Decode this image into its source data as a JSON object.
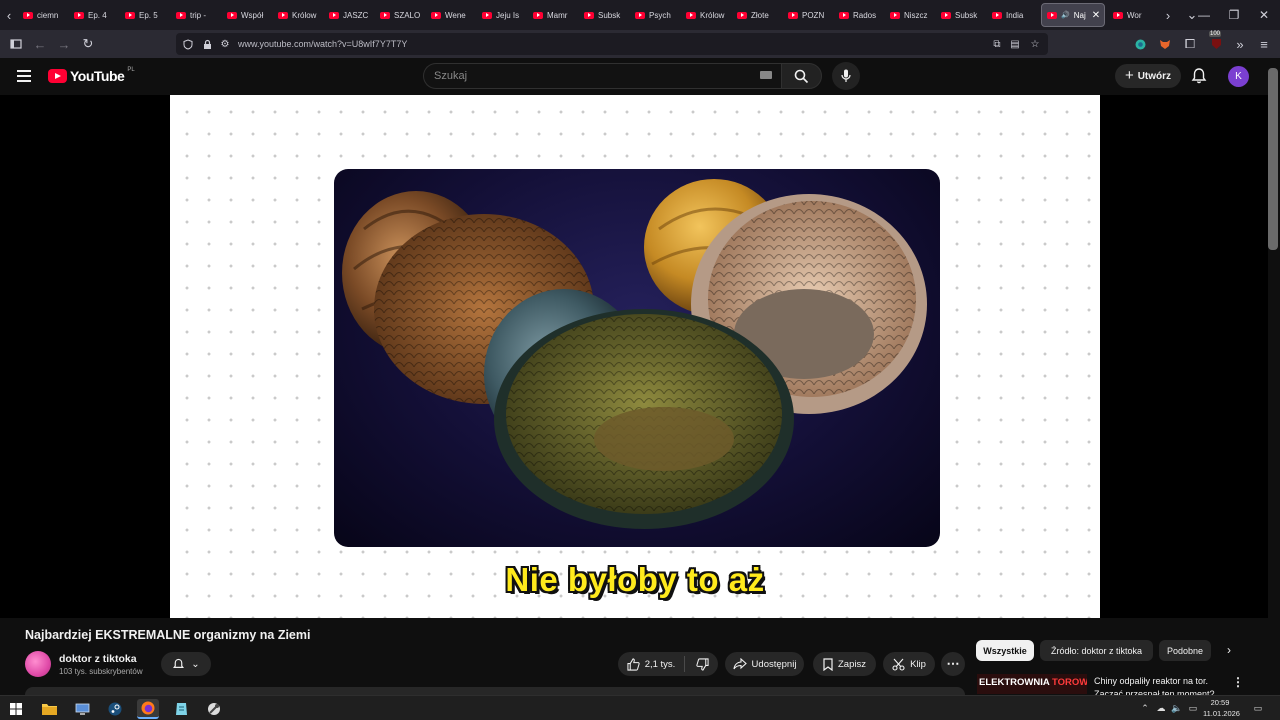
{
  "browser": {
    "tabs": [
      "ciemn",
      "Ep. 4",
      "Ep. 5",
      "trip -",
      "Współ",
      "Królow",
      "JASZC",
      "SZALO",
      "Wene",
      "Jeju Is",
      "Mamr",
      "Subsk",
      "Psych",
      "Królow",
      "Złote",
      "POZN",
      "Rados",
      "Niszcz",
      "Subsk",
      "India",
      "Naj",
      "Wor"
    ],
    "active_tab_index": 20,
    "url": "www.youtube.com/watch?v=U8wIf7Y7T7Y",
    "extension_badge": "100"
  },
  "youtube": {
    "logo_text": "YouTube",
    "region": "PL",
    "search_placeholder": "Szukaj",
    "create_label": "Utwórz",
    "account_initial": "K"
  },
  "player": {
    "caption": "Nie byłoby to aż"
  },
  "video": {
    "title": "Najbardziej EKSTREMALNE organizmy na Ziemi",
    "channel_name": "doktor z tiktoka",
    "subscribers": "103 tys. subskrybentów",
    "likes": "2,1 tys.",
    "share_label": "Udostępnij",
    "save_label": "Zapisz",
    "clip_label": "Klip"
  },
  "sidebar": {
    "chips": [
      "Wszystkie",
      "Źródło: doktor z tiktoka",
      "Podobne"
    ],
    "selected_chip": "Wszystkie",
    "recommendation": {
      "thumb_text_white": "ELEKTROWNIA ",
      "thumb_text_red": "TOROWA",
      "thumb_text_end": "?",
      "title": "Chiny odpaliły reaktor na tor. Zacząć przespał ten moment?"
    }
  },
  "taskbar": {
    "time": "20:59",
    "date": "11.01.2026"
  },
  "colors": {
    "yt_red": "#ff0033",
    "caption_yellow": "#ffea1c",
    "avatar_purple": "#7b3fd1"
  }
}
